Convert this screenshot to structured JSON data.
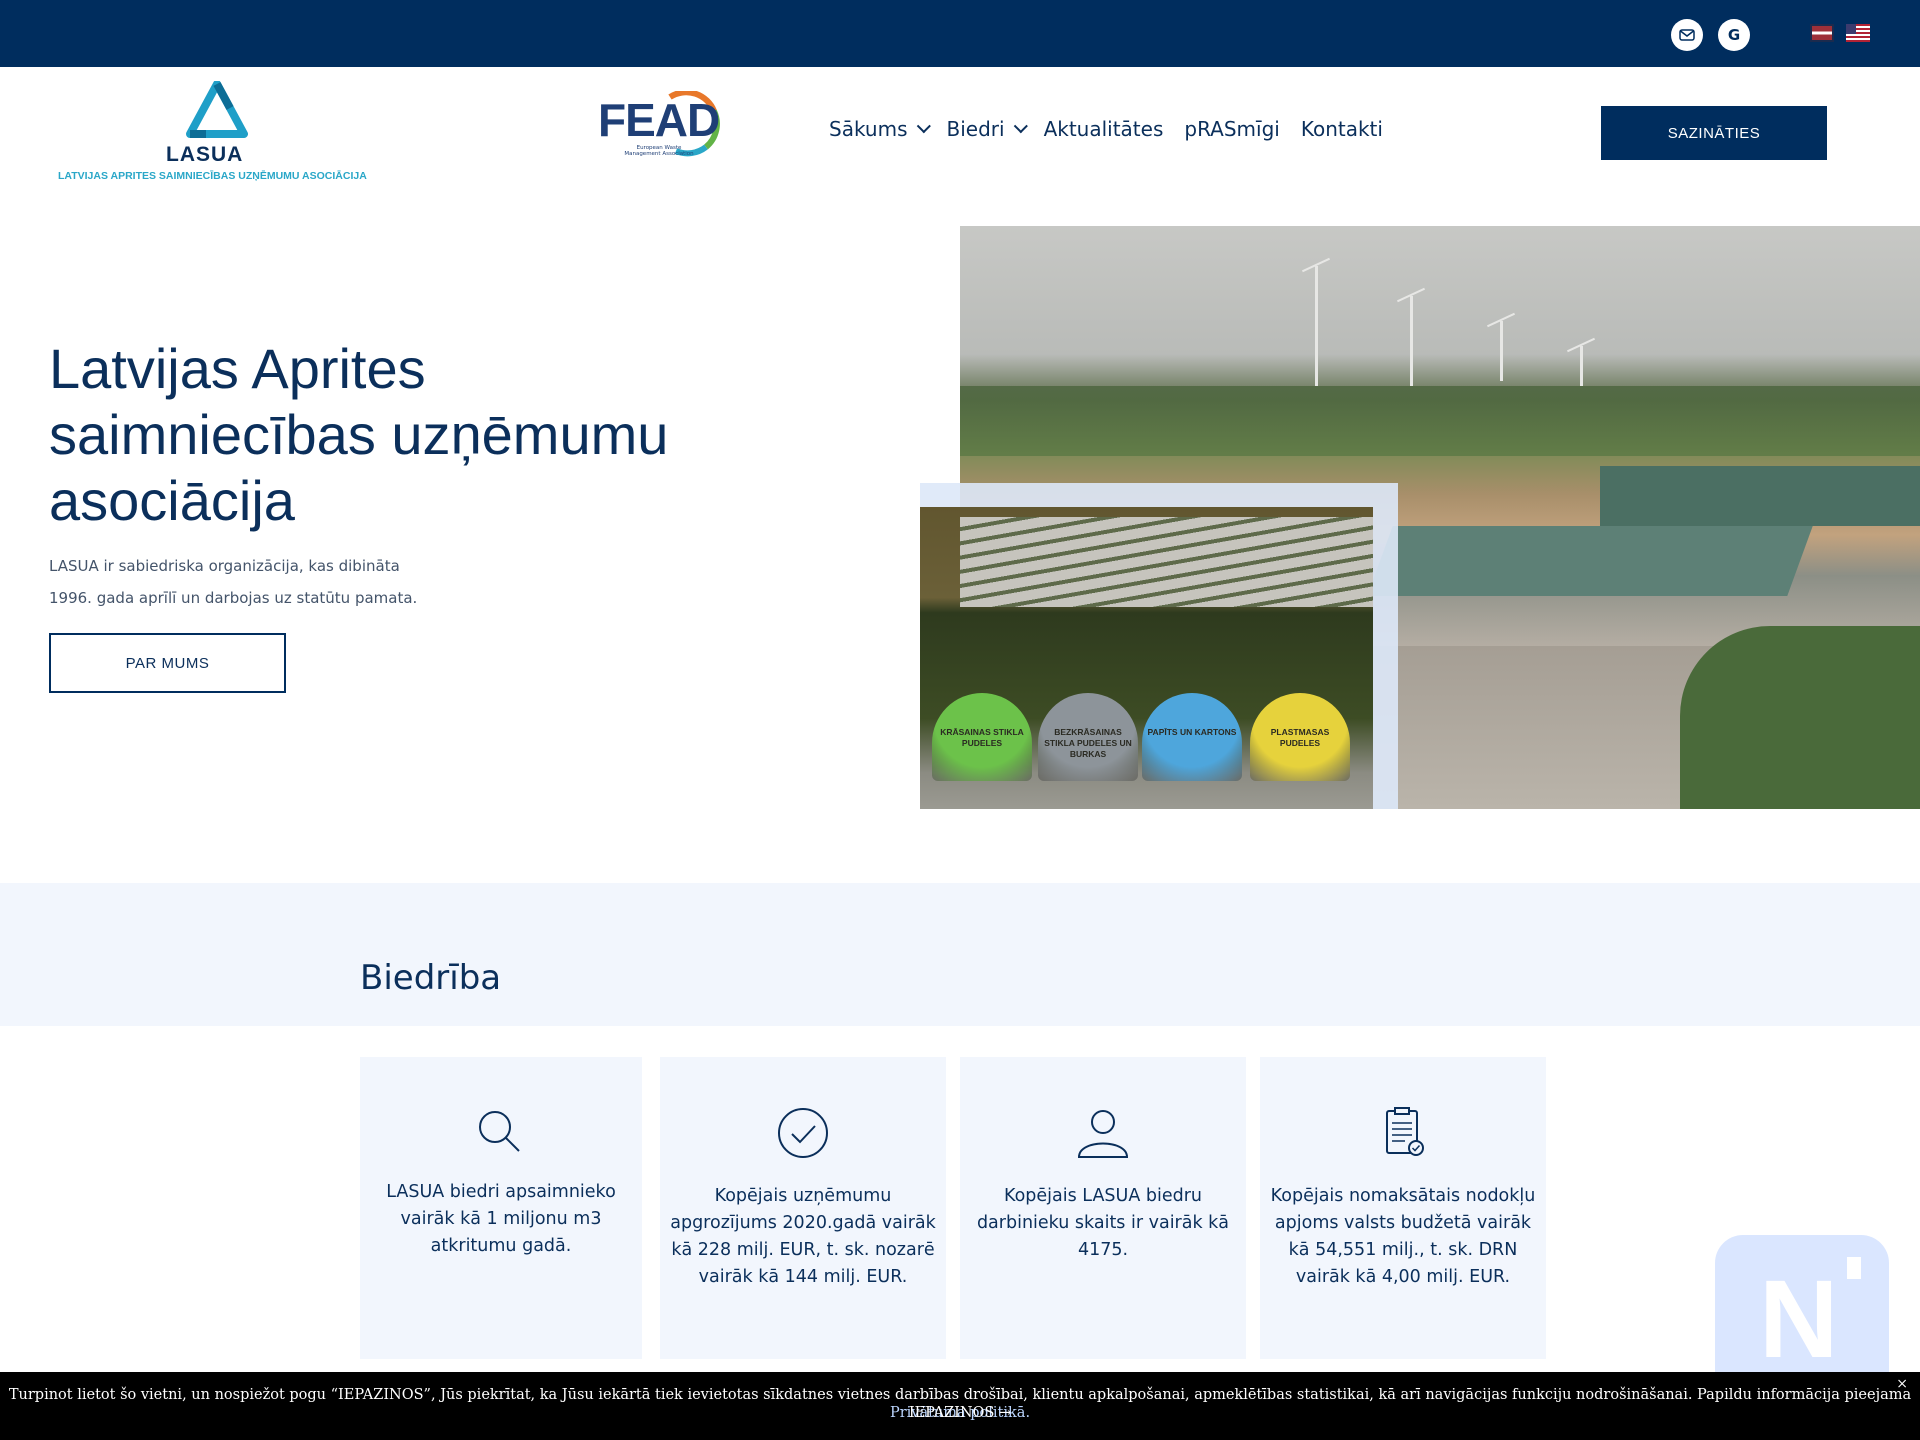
{
  "topbar": {
    "email_icon": "envelope-icon",
    "google_icon": "google-icon",
    "google_glyph": "G",
    "languages": [
      "lv",
      "en"
    ]
  },
  "header": {
    "logo_lasua_word": "LASUA",
    "logo_lasua_sub": "LATVIJAS APRITES SAIMNIECĪBAS UZŅĒMUMU ASOCIĀCIJA",
    "logo_fead_word": "FEAD",
    "logo_fead_sub": "European Waste Management Association",
    "nav": [
      {
        "label": "Sākums",
        "has_dropdown": true
      },
      {
        "label": "Biedri",
        "has_dropdown": true
      },
      {
        "label": "Aktualitātes",
        "has_dropdown": false
      },
      {
        "label": "pRASmīgi",
        "has_dropdown": false
      },
      {
        "label": "Kontakti",
        "has_dropdown": false
      }
    ],
    "cta_label": "SAZINĀTIES"
  },
  "hero": {
    "title": "Latvijas Aprites saimniecības uzņēmumu asociācija",
    "description_line1": "LASUA ir sabiedriska organizācija, kas dibināta",
    "description_line2": "1996. gada aprīlī un darbojas uz statūtu pamata.",
    "button_label": "PAR MUMS",
    "bins": [
      {
        "label": "KRĀSAINAS STIKLA PUDELES",
        "color": "#6cc24a"
      },
      {
        "label": "BEZKRĀSAINAS STIKLA PUDELES UN BURKAS",
        "color": "#8d949a"
      },
      {
        "label": "PAPĪTS UN KARTONS",
        "color": "#4ea6dc"
      },
      {
        "label": "PLASTMASAS PUDELES",
        "color": "#e6d23c"
      }
    ]
  },
  "section": {
    "title": "Biedrība",
    "cards": [
      {
        "icon": "search-icon",
        "text": "LASUA biedri apsaimnieko vairāk kā 1 miljonu m3 atkritumu gadā."
      },
      {
        "icon": "check-circle-icon",
        "text": "Kopējais uzņēmumu apgrozījums 2020.gadā vairāk kā 228 milj. EUR, t. sk. nozarē vairāk kā 144 milj. EUR."
      },
      {
        "icon": "user-icon",
        "text": "Kopējais LASUA biedru darbinieku skaits ir vairāk kā 4175."
      },
      {
        "icon": "clipboard-check-icon",
        "text": "Kopējais nomaksātais nodokļu apjoms valsts budžetā vairāk kā 54,551 milj., t. sk. DRN vairāk kā 4,00 milj. EUR."
      }
    ]
  },
  "cookie": {
    "text": "Turpinot lietot šo vietni, un nospiežot pogu “IEPAZINOS”, Jūs piekrītat, ka Jūsu iekārtā tiek ievietotas sīkdatnes vietnes darbības drošībai, klientu apkalpošanai, apmeklētības statistikai, kā arī navigācijas funkciju nodrošināšanai. Papildu informācija pieejama",
    "link": "Privātuma politikā.",
    "accept": "IEPAZINOS →",
    "close": "×"
  },
  "chat_badge": {
    "letter": "N"
  },
  "colors": {
    "primary": "#002d5e",
    "light_band": "#f2f6fd",
    "logo_accent": "#2aa7c8"
  }
}
